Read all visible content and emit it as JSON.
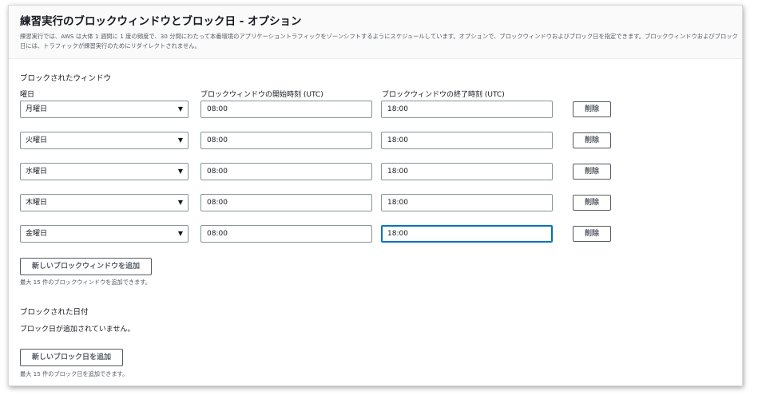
{
  "header": {
    "title": "練習実行のブロックウィンドウとブロック日 - オプション",
    "description": "練習実行では、AWS は大体 1 週間に 1 度の頻度で、30 分間にわたって本番環境のアプリケーショントラフィックをゾーンシフトするようにスケジュールしています。オプションで、ブロックウィンドウおよびブロック日を指定できます。ブロックウィンドウおよびブロック日には、トラフィックが練習実行のためにリダイレクトされません。"
  },
  "blocked_windows": {
    "section_label": "ブロックされたウィンドウ",
    "col_day": "曜日",
    "col_start": "ブロックウィンドウの開始時刻 (UTC)",
    "col_end": "ブロックウィンドウの終了時刻 (UTC)",
    "rows": [
      {
        "day": "月曜日",
        "start": "08:00",
        "end": "18:00",
        "remove": "削除"
      },
      {
        "day": "火曜日",
        "start": "08:00",
        "end": "18:00",
        "remove": "削除"
      },
      {
        "day": "水曜日",
        "start": "08:00",
        "end": "18:00",
        "remove": "削除"
      },
      {
        "day": "木曜日",
        "start": "08:00",
        "end": "18:00",
        "remove": "削除"
      },
      {
        "day": "金曜日",
        "start": "08:00",
        "end": "18:00",
        "remove": "削除"
      }
    ],
    "add_button": "新しいブロックウィンドウを追加",
    "add_hint": "最大 15 件のブロックウィンドウを追加できます。"
  },
  "blocked_dates": {
    "section_label": "ブロックされた日付",
    "empty_text": "ブロック日が追加されていません。",
    "add_button": "新しいブロック日を追加",
    "add_hint": "最大 15 件のブロック日を追加できます。"
  },
  "icons": {
    "dropdown": "caret-down-icon"
  },
  "colors": {
    "focus_border": "#0073bb",
    "border": "#879596",
    "header_bg": "#fafafa"
  }
}
